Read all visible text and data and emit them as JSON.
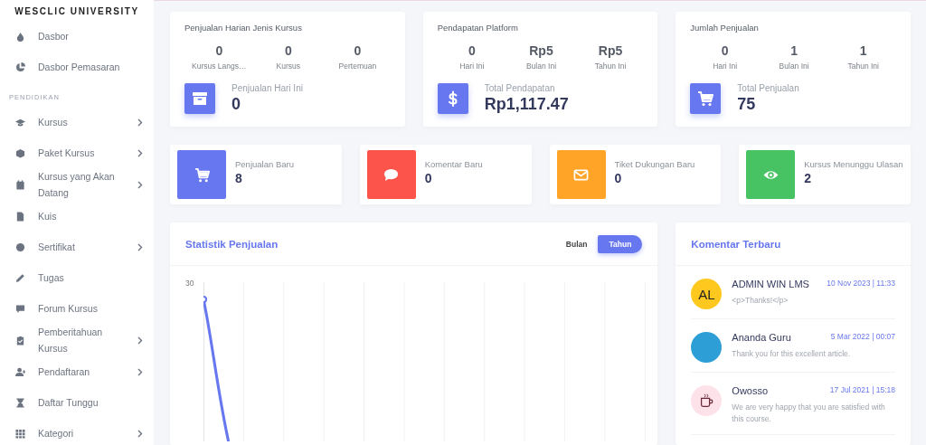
{
  "sidebar": {
    "brand": "WESCLIC UNIVERSITY",
    "items": [
      {
        "kind": "link",
        "label": "Dasbor",
        "expandable": false
      },
      {
        "kind": "link",
        "label": "Dasbor Pemasaran",
        "expandable": false
      },
      {
        "kind": "heading",
        "label": "PENDIDIKAN"
      },
      {
        "kind": "link",
        "label": "Kursus",
        "expandable": true
      },
      {
        "kind": "link",
        "label": "Paket Kursus",
        "expandable": true
      },
      {
        "kind": "link",
        "label": "Kursus yang Akan Datang",
        "expandable": true
      },
      {
        "kind": "link",
        "label": "Kuis",
        "expandable": false
      },
      {
        "kind": "link",
        "label": "Sertifikat",
        "expandable": true
      },
      {
        "kind": "link",
        "label": "Tugas",
        "expandable": false
      },
      {
        "kind": "link",
        "label": "Forum Kursus",
        "expandable": false
      },
      {
        "kind": "link",
        "label": "Pemberitahuan Kursus",
        "expandable": true
      },
      {
        "kind": "link",
        "label": "Pendaftaran",
        "expandable": true
      },
      {
        "kind": "link",
        "label": "Daftar Tunggu",
        "expandable": false
      },
      {
        "kind": "link",
        "label": "Kategori",
        "expandable": true
      }
    ]
  },
  "summary_cards": [
    {
      "title": "Penjualan Harian Jenis Kursus",
      "stats": [
        {
          "value": "0",
          "label": "Kursus Langs…"
        },
        {
          "value": "0",
          "label": "Kursus"
        },
        {
          "value": "0",
          "label": "Pertemuan"
        }
      ],
      "total_label": "Penjualan Hari Ini",
      "total_value": "0"
    },
    {
      "title": "Pendapatan Platform",
      "stats": [
        {
          "value": "0",
          "label": "Hari Ini"
        },
        {
          "value": "Rp5",
          "label": "Bulan Ini"
        },
        {
          "value": "Rp5",
          "label": "Tahun Ini"
        }
      ],
      "total_label": "Total Pendapatan",
      "total_value": "Rp1,117.47"
    },
    {
      "title": "Jumlah Penjualan",
      "stats": [
        {
          "value": "0",
          "label": "Hari Ini"
        },
        {
          "value": "1",
          "label": "Bulan Ini"
        },
        {
          "value": "1",
          "label": "Tahun Ini"
        }
      ],
      "total_label": "Total Penjualan",
      "total_value": "75"
    }
  ],
  "quick_stats": [
    {
      "label": "Penjualan Baru",
      "value": "8",
      "color": "#6777ef"
    },
    {
      "label": "Komentar Baru",
      "value": "0",
      "color": "#fc544b"
    },
    {
      "label": "Tiket Dukungan Baru",
      "value": "0",
      "color": "#ffa426"
    },
    {
      "label": "Kursus Menunggu Ulasan",
      "value": "2",
      "color": "#47c363"
    }
  ],
  "sales_chart": {
    "title": "Statistik Penjualan",
    "toggle": [
      {
        "label": "Bulan",
        "selected": false
      },
      {
        "label": "Tahun",
        "selected": true
      }
    ],
    "y_tick": "30"
  },
  "recent_comments": {
    "title": "Komentar Terbaru",
    "items": [
      {
        "kind": "initials",
        "initials": "AL",
        "name": "ADMIN WIN LMS",
        "date": "10 Nov 2023 | 11:33",
        "text": "<p>Thanks!</p>"
      },
      {
        "kind": "photo",
        "name": "Ananda Guru",
        "date": "5 Mar 2022 | 00:07",
        "text": "Thank you for this excellent article."
      },
      {
        "kind": "logo",
        "name": "Owosso",
        "date": "17 Jul 2021 | 15:18",
        "text": "We are very happy that you are satisfied with this course."
      }
    ]
  }
}
